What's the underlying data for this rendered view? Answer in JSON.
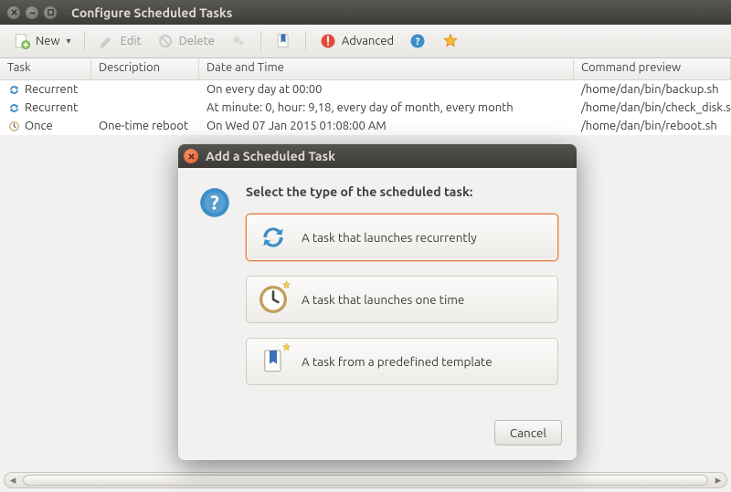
{
  "window": {
    "title": "Configure Scheduled Tasks"
  },
  "toolbar": {
    "new": "New",
    "edit": "Edit",
    "delete": "Delete",
    "advanced": "Advanced"
  },
  "columns": {
    "task": "Task",
    "description": "Description",
    "datetime": "Date and Time",
    "command": "Command preview"
  },
  "rows": [
    {
      "icon": "recur",
      "task": "Recurrent",
      "description": "",
      "datetime": "On every day at 00:00",
      "command": "/home/dan/bin/backup.sh"
    },
    {
      "icon": "recur",
      "task": "Recurrent",
      "description": "",
      "datetime": "At minute: 0, hour: 9,18, every day of month, every month",
      "command": "/home/dan/bin/check_disk.sh"
    },
    {
      "icon": "once",
      "task": "Once",
      "description": "One-time reboot",
      "datetime": "On Wed 07 Jan 2015 01:08:00 AM",
      "command": "/home/dan/bin/reboot.sh"
    }
  ],
  "modal": {
    "title": "Add a Scheduled Task",
    "prompt": "Select the type of the scheduled task:",
    "options": {
      "recurrent": "A task that launches recurrently",
      "once": "A task that launches one time",
      "template": "A task from a predefined template"
    },
    "cancel": "Cancel"
  }
}
